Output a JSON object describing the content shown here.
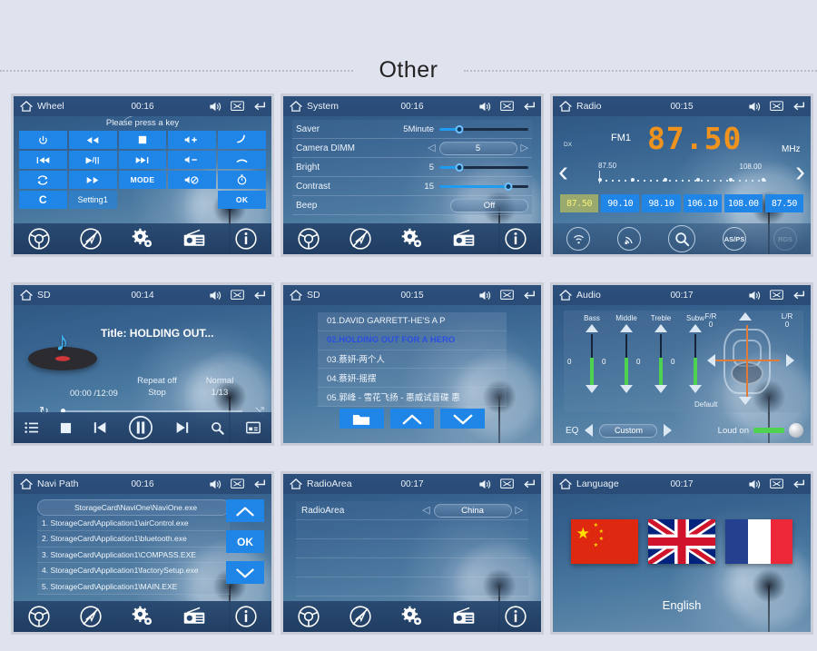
{
  "page": {
    "title": "Other"
  },
  "panels": {
    "wheel": {
      "title": "Wheel",
      "clock": "00:16",
      "hint": "Please press a key",
      "keys": [
        {
          "label": "⏻",
          "name": "power-key"
        },
        {
          "label": "◀◀",
          "name": "rewind-key"
        },
        {
          "label": "■",
          "name": "stop-key"
        },
        {
          "label": "🔊+",
          "name": "volume-up-key"
        },
        {
          "label": "📞",
          "name": "call-answer-key"
        },
        {
          "label": "|◀◀",
          "name": "previous-key"
        },
        {
          "label": "▶/||",
          "name": "play-pause-key"
        },
        {
          "label": "▶▶|",
          "name": "next-key"
        },
        {
          "label": "🔊−",
          "name": "volume-down-key"
        },
        {
          "label": "📞",
          "name": "call-end-key"
        },
        {
          "label": "⟳",
          "name": "repeat-key"
        },
        {
          "label": "▶▶",
          "name": "fast-forward-key"
        },
        {
          "label": "MODE",
          "name": "mode-key"
        },
        {
          "label": "🔇",
          "name": "mute-key"
        },
        {
          "label": "⏱",
          "name": "timer-key"
        },
        {
          "label": "C",
          "name": "clear-key"
        },
        {
          "label": "Setting1",
          "name": "setting1-key"
        },
        {
          "label": "",
          "name": "empty-key-1"
        },
        {
          "label": "",
          "name": "empty-key-2"
        },
        {
          "label": "OK",
          "name": "ok-key"
        }
      ]
    },
    "system": {
      "title": "System",
      "clock": "00:16",
      "rows": [
        {
          "label": "Saver",
          "value": "5Minute",
          "type": "slider",
          "percent": 22
        },
        {
          "label": "Camera DIMM",
          "value": "5",
          "type": "stepper"
        },
        {
          "label": "Bright",
          "value": "5",
          "type": "slider",
          "percent": 22
        },
        {
          "label": "Contrast",
          "value": "15",
          "type": "slider",
          "percent": 78
        },
        {
          "label": "Beep",
          "value": "Off",
          "type": "pill"
        }
      ]
    },
    "radio": {
      "title": "Radio",
      "clock": "00:15",
      "dx": "DX",
      "band": "FM1",
      "frequency": "87.50",
      "unit": "MHz",
      "scale_min": "87.50",
      "scale_max": "108.00",
      "presets": [
        "87.50",
        "90.10",
        "98.10",
        "106.10",
        "108.00",
        "87.50"
      ],
      "active_preset_index": 0,
      "buttons": [
        "loc-dx-icon",
        "st-mono-icon",
        "scan-icon",
        "AS/PS",
        "RDS"
      ],
      "as_ps_label": "AS/PS",
      "rds_label": "RDS"
    },
    "sd_player": {
      "title": "SD",
      "clock": "00:14",
      "track_title": "Title: HOLDING OUT...",
      "repeat": "Repeat off",
      "state": "Stop",
      "mode": "Normal",
      "track_index": "1/13",
      "time": "00:00 /12:09"
    },
    "sd_list": {
      "title": "SD",
      "clock": "00:15",
      "tracks": [
        "01.DAVID GARRETT-HE'S A P",
        "02.HOLDING OUT FOR A HERO",
        "03.蔡妍-两个人",
        "04.蔡妍-摇摆",
        "05.郭峰 - 雪花飞扬 - 惠威试音碟 惠"
      ],
      "selected_index": 1,
      "buttons": [
        "folder-icon",
        "up-arrow-icon",
        "down-arrow-icon"
      ]
    },
    "audio": {
      "title": "Audio",
      "clock": "00:17",
      "bands": [
        {
          "name": "Bass",
          "value": "0"
        },
        {
          "name": "Middle",
          "value": "0"
        },
        {
          "name": "Treble",
          "value": "0"
        },
        {
          "name": "Subw",
          "value": "0"
        }
      ],
      "fader": {
        "fr_label": "F/R",
        "fr_value": "0",
        "lr_label": "L/R",
        "lr_value": "0",
        "default_label": "Default"
      },
      "eq_label": "EQ",
      "eq_value": "Custom",
      "loud_label": "Loud on"
    },
    "navi": {
      "title": "Navi Path",
      "clock": "00:16",
      "current_path": "StorageCard\\NaviOne\\NaviOne.exe",
      "entries": [
        "1. StorageCard\\Application1\\airControl.exe",
        "2. StorageCard\\Application1\\bluetooth.exe",
        "3. StorageCard\\Application1\\COMPASS.EXE",
        "4. StorageCard\\Application1\\factorySetup.exe",
        "5. StorageCard\\Application1\\MAIN.EXE"
      ],
      "ok_label": "OK"
    },
    "radio_area": {
      "title": "RadioArea",
      "clock": "00:17",
      "row_label": "RadioArea",
      "row_value": "China"
    },
    "language": {
      "title": "Language",
      "clock": "00:17",
      "selected": "English",
      "flags": [
        "china-flag",
        "united-kingdom-flag",
        "france-flag"
      ]
    }
  },
  "toolbar": {
    "icons": [
      "steering-wheel-icon",
      "no-navigation-icon",
      "settings-gear-icon",
      "radio-icon",
      "info-icon"
    ]
  },
  "player_bar": {
    "icons": [
      "playlist-icon",
      "stop-icon",
      "previous-icon",
      "pause-icon",
      "next-icon",
      "search-icon",
      "display-icon"
    ]
  },
  "colors": {
    "accent_blue": "#1f86e8",
    "frequency_orange": "#f0921e",
    "selected_green": "#9aaa6e",
    "eq_green": "#4fd24f",
    "background": "#dfe3ee",
    "panel_border": "#c9cdd8"
  }
}
